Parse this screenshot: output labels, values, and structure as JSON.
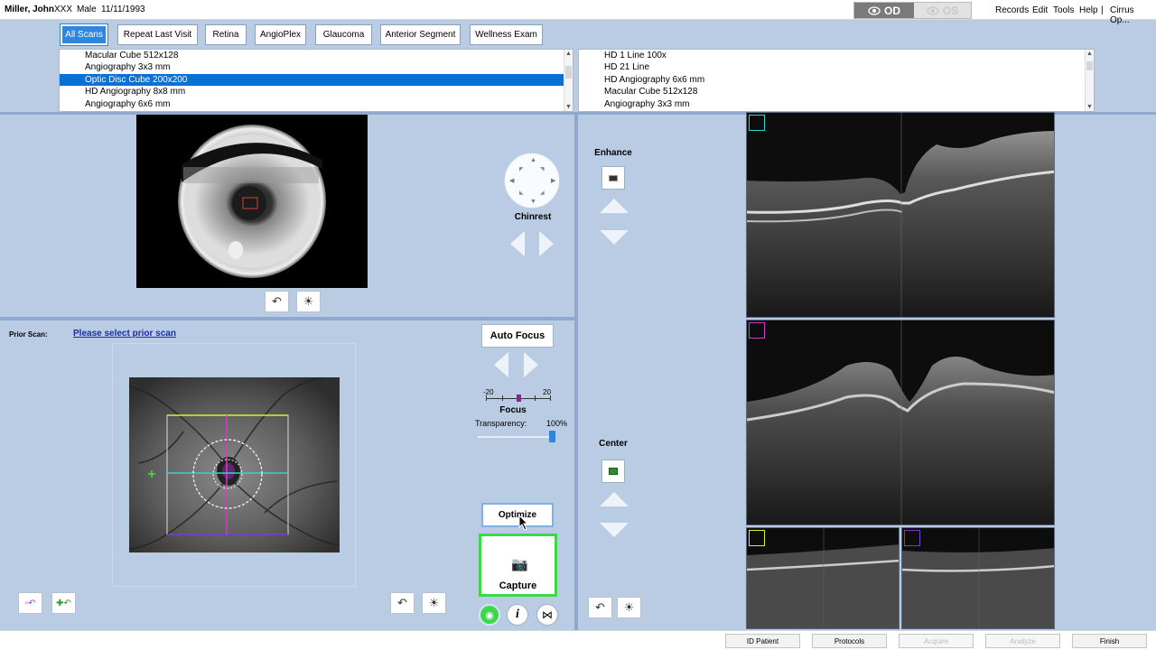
{
  "patient": {
    "name": "Miller, John",
    "id": "XXX",
    "gender": "Male",
    "dob": "11/11/1993"
  },
  "eye_toggle": {
    "od": "OD",
    "os": "OS"
  },
  "menu": {
    "records": "Records",
    "edit": "Edit",
    "tools": "Tools",
    "help": "Help",
    "sep": "|",
    "app": "Cirrus Op..."
  },
  "tabs": [
    "All Scans",
    "Repeat Last Visit",
    "Retina",
    "AngioPlex",
    "Glaucoma",
    "Anterior Segment",
    "Wellness Exam"
  ],
  "scan_list_left": [
    "Macular Cube 512x128",
    "Angiography 3x3 mm",
    "Optic Disc Cube 200x200",
    "HD Angiography 8x8 mm",
    "Angiography 6x6 mm"
  ],
  "scan_list_left_selected": 2,
  "scan_list_right": [
    "HD 1 Line 100x",
    "HD 21 Line",
    "HD Angiography 6x6 mm",
    "Macular Cube 512x128",
    "Angiography 3x3 mm"
  ],
  "iris": {
    "chinrest_label": "Chinrest"
  },
  "prior": {
    "label": "Prior Scan:",
    "link": "Please select prior scan"
  },
  "focus": {
    "button": "Auto Focus",
    "min": "-20",
    "max": "20",
    "value": 0,
    "label": "Focus"
  },
  "transparency": {
    "label": "Transparency:",
    "value": "100%"
  },
  "actions": {
    "optimize": "Optimize",
    "capture": "Capture"
  },
  "oct_controls": {
    "enhance": "Enhance",
    "center": "Center"
  },
  "footer": {
    "id_patient": "ID Patient",
    "protocols": "Protocols",
    "acquire": "Acquire",
    "analyze": "Analyze",
    "finish": "Finish"
  },
  "colors": {
    "accent": "#2e86de",
    "selection": "#0a6fd6",
    "panel_bg": "#b9cce3",
    "capture_border": "#3ed64a"
  },
  "icons": [
    "eye-icon",
    "undo-icon",
    "brightness-icon",
    "camera-icon",
    "info-icon",
    "scan-mode-icon",
    "eye-view-icon"
  ]
}
